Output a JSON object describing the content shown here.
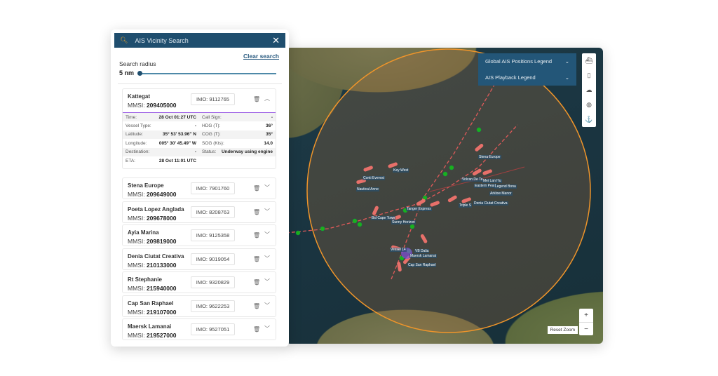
{
  "panel": {
    "title": "AIS Vicinity Search",
    "search_icon": "search-icon",
    "close_icon": "close-icon",
    "clear_search": "Clear search",
    "radius_label": "Search radius",
    "radius_value": "5 nm",
    "radius_fraction": 0.0
  },
  "expanded": {
    "name": "Kattegat",
    "mmsi_label": "MMSI:",
    "mmsi": "209405000",
    "imo": "IMO: 9112765",
    "rows": [
      [
        [
          "Time:",
          "28 Oct 01:27 UTC"
        ],
        [
          "Call Sign:",
          "-"
        ]
      ],
      [
        [
          "Vessel Type:",
          "-"
        ],
        [
          "HDG (T):",
          "36°"
        ]
      ],
      [
        [
          "Latitude:",
          "35° 53' 53.96\" N"
        ],
        [
          "COG (T):",
          "35°"
        ]
      ],
      [
        [
          "Longitude:",
          "005° 30' 45.49\" W"
        ],
        [
          "SOG (Kts):",
          "14.0"
        ]
      ],
      [
        [
          "Destination:",
          "-"
        ],
        [
          "Status:",
          "Underway using engine"
        ]
      ],
      [
        [
          "ETA:",
          "28 Oct 11:01 UTC"
        ],
        [
          "",
          ""
        ]
      ]
    ]
  },
  "vessels": [
    {
      "name": "Stena Europe",
      "mmsi": "209649000",
      "imo": "IMO: 7901760"
    },
    {
      "name": "Poeta Lopez Anglada",
      "mmsi": "209678000",
      "imo": "IMO: 8208763"
    },
    {
      "name": "Ayia Marina",
      "mmsi": "209819000",
      "imo": "IMO: 9125358"
    },
    {
      "name": "Denia Ciutat Creativa",
      "mmsi": "210133000",
      "imo": "IMO: 9019054"
    },
    {
      "name": "Rt Stephanie",
      "mmsi": "215940000",
      "imo": "IMO: 9320829"
    },
    {
      "name": "Cap San Raphael",
      "mmsi": "219107000",
      "imo": "IMO: 9622253"
    },
    {
      "name": "Maersk Lamanai",
      "mmsi": "219527000",
      "imo": "IMO: 9527051"
    }
  ],
  "map": {
    "legend_global": "Global AIS Positions Legend",
    "legend_playback": "AIS Playback Legend",
    "reset_zoom": "Reset Zoom",
    "zoom_in": "+",
    "zoom_out": "−",
    "labels": [
      "Stena Europe",
      "Conti Everest",
      "Key West",
      "Nautical Anne",
      "Volcan De Ta",
      "Mei Lan Hu",
      "Eastern Pearl",
      "Legend Bona",
      "Arklow Manor",
      "Tanger Express",
      "Bsl Cape Town",
      "Sunny Horizon",
      "Denia Ciutat Creativa",
      "Triple S",
      "Vessel 14",
      "VB Dalia",
      "Maersk Lamanai",
      "Cap San Raphael"
    ],
    "circle_color": "#f0952a",
    "track_color": "#e05a5a",
    "vessel_color": "#e8706a"
  }
}
